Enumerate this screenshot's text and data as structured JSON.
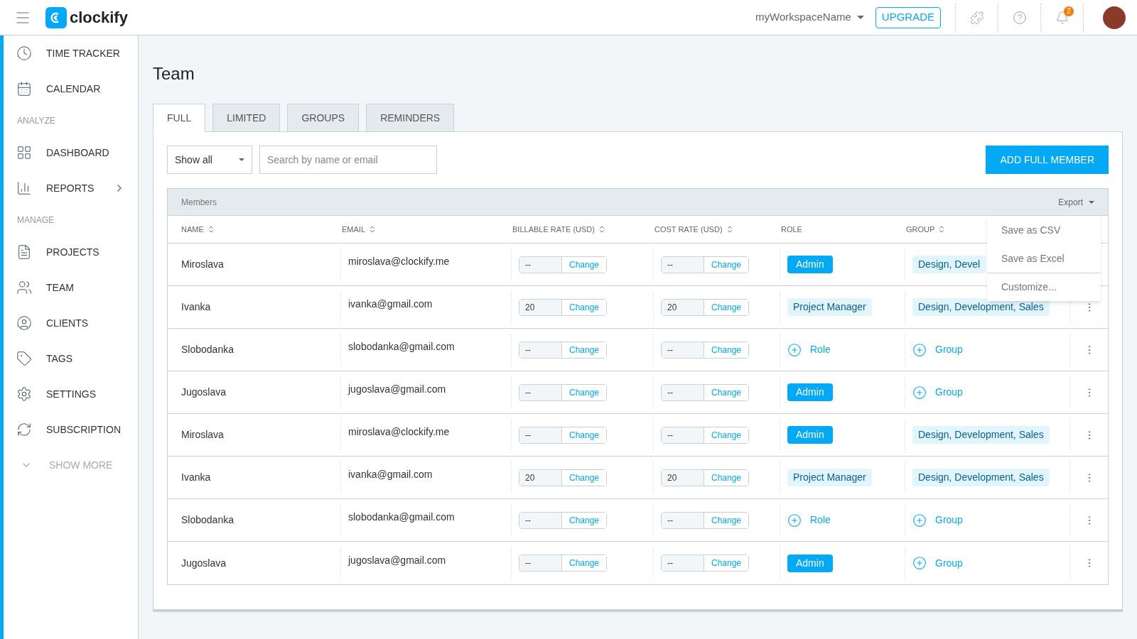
{
  "header": {
    "logo": "clockify",
    "workspace": "myWorkspaceName",
    "upgrade": "UPGRADE",
    "notifications": "2"
  },
  "sidebar": {
    "items": [
      {
        "kind": "item",
        "label": "TIME TRACKER",
        "selected": false
      },
      {
        "kind": "item",
        "label": "CALENDAR",
        "selected": false
      },
      {
        "kind": "section",
        "label": "ANALYZE"
      },
      {
        "kind": "item",
        "label": "DASHBOARD",
        "selected": false
      },
      {
        "kind": "item",
        "label": "REPORTS",
        "selected": false,
        "expandable": true
      },
      {
        "kind": "section",
        "label": "MANAGE"
      },
      {
        "kind": "item",
        "label": "PROJECTS",
        "selected": false
      },
      {
        "kind": "item",
        "label": "TEAM",
        "selected": false
      },
      {
        "kind": "item",
        "label": "CLIENTS",
        "selected": false
      },
      {
        "kind": "item",
        "label": "TAGS",
        "selected": false
      },
      {
        "kind": "item",
        "label": "SETTINGS",
        "selected": false
      },
      {
        "kind": "item",
        "label": "SUBSCRIPTION",
        "selected": false
      },
      {
        "kind": "more",
        "label": "SHOW MORE"
      }
    ]
  },
  "page": {
    "title": "Team"
  },
  "tabs": [
    {
      "label": "FULL",
      "selected": true
    },
    {
      "label": "LIMITED",
      "selected": false
    },
    {
      "label": "GROUPS",
      "selected": false
    },
    {
      "label": "REMINDERS",
      "selected": false
    }
  ],
  "filter": {
    "value": "Show all"
  },
  "search": {
    "placeholder": "Search by name or email"
  },
  "add_button": "ADD FULL MEMBER",
  "table": {
    "title": "Members",
    "export": "Export",
    "columns": [
      {
        "label": "NAME",
        "sortable": true
      },
      {
        "label": "EMAIL",
        "sortable": true
      },
      {
        "label": "BILLABLE RATE (USD)",
        "sortable": true
      },
      {
        "label": "COST RATE (USD)",
        "sortable": true
      },
      {
        "label": "ROLE",
        "sortable": false
      },
      {
        "label": "GROUP",
        "sortable": true
      }
    ],
    "rows": [
      {
        "name": "Miroslava",
        "email": "miroslava@clockify.me",
        "billable": "--",
        "billable_action": "Change",
        "cost": "--",
        "cost_action": "Change",
        "role": {
          "kind": "admin",
          "text": "Admin"
        },
        "group": {
          "kind": "tag",
          "text": "Design, Devel"
        }
      },
      {
        "name": "Ivanka",
        "email": "ivanka@gmail.com",
        "billable": "20",
        "billable_action": "Change",
        "cost": "20",
        "cost_action": "Change",
        "role": {
          "kind": "role",
          "text": "Project Manager"
        },
        "group": {
          "kind": "tag",
          "text": "Design, Development, Sales"
        }
      },
      {
        "name": "Slobodanka",
        "email": "slobodanka@gmail.com",
        "billable": "--",
        "billable_action": "Change",
        "cost": "--",
        "cost_action": "Change",
        "role": {
          "kind": "add",
          "text": "Role"
        },
        "group": {
          "kind": "add",
          "text": "Group"
        }
      },
      {
        "name": "Jugoslava",
        "email": "jugoslava@gmail.com",
        "billable": "--",
        "billable_action": "Change",
        "cost": "--",
        "cost_action": "Change",
        "role": {
          "kind": "admin",
          "text": "Admin"
        },
        "group": {
          "kind": "add",
          "text": "Group"
        }
      },
      {
        "name": "Miroslava",
        "email": "miroslava@clockify.me",
        "billable": "--",
        "billable_action": "Change",
        "cost": "--",
        "cost_action": "Change",
        "role": {
          "kind": "admin",
          "text": "Admin"
        },
        "group": {
          "kind": "tag",
          "text": "Design, Development, Sales"
        }
      },
      {
        "name": "Ivanka",
        "email": "ivanka@gmail.com",
        "billable": "20",
        "billable_action": "Change",
        "cost": "20",
        "cost_action": "Change",
        "role": {
          "kind": "role",
          "text": "Project Manager"
        },
        "group": {
          "kind": "tag",
          "text": "Design, Development, Sales"
        }
      },
      {
        "name": "Slobodanka",
        "email": "slobodanka@gmail.com",
        "billable": "--",
        "billable_action": "Change",
        "cost": "--",
        "cost_action": "Change",
        "role": {
          "kind": "add",
          "text": "Role"
        },
        "group": {
          "kind": "add",
          "text": "Group"
        }
      },
      {
        "name": "Jugoslava",
        "email": "jugoslava@gmail.com",
        "billable": "--",
        "billable_action": "Change",
        "cost": "--",
        "cost_action": "Change",
        "role": {
          "kind": "admin",
          "text": "Admin"
        },
        "group": {
          "kind": "add",
          "text": "Group"
        }
      }
    ]
  },
  "export_menu": [
    {
      "label": "Save as CSV",
      "separated": false
    },
    {
      "label": "Save as Excel",
      "separated": false
    },
    {
      "label": "Customize...",
      "separated": true
    }
  ]
}
